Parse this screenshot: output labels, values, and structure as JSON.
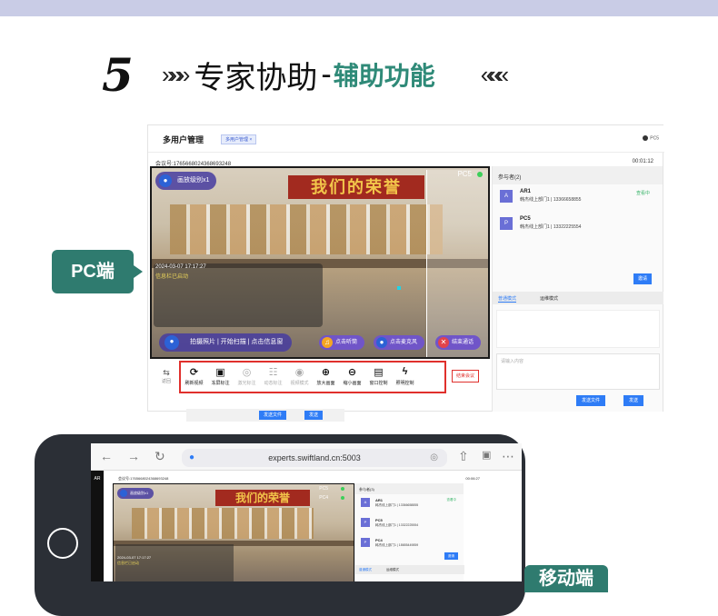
{
  "heading": {
    "number": "5",
    "chevrons_left": "»»»",
    "title": "专家协助",
    "separator": "-",
    "subtitle": "辅助功能",
    "chevrons_right": "«««"
  },
  "colors": {
    "accent": "#2f7b6f",
    "subtitle": "#2f8a78",
    "highlight_border": "#e0302c",
    "primary_button": "#2e7cf6",
    "top_bar": "#c9cce6"
  },
  "labels": {
    "pc": "PC端",
    "mobile": "移动端"
  },
  "pc": {
    "app_title": "多用户管理",
    "app_tab": "多用户管理 ×",
    "user": "PC5",
    "meeting_id": "会议号:1765668024368693248",
    "timer": "00:01:12",
    "video": {
      "scale_pill": "画放级别x1",
      "banner": "我们的荣誉",
      "feed_label": "PC5",
      "timestamp": "2024-03-07 17:17:27",
      "info": "信息栏已启动",
      "capture_hint": "拍摄照片 | 开始扫描 | 点击信息窗",
      "listen": "点击听筒",
      "mic": "点击麦克风",
      "end_call": "结束通话"
    },
    "back": {
      "icon": "back-arrow-icon",
      "label": "返回"
    },
    "tools": [
      {
        "icon": "⟳",
        "label": "刷新视频",
        "enabled": true
      },
      {
        "icon": "▣",
        "label": "冻屏标注",
        "enabled": true
      },
      {
        "icon": "◎",
        "label": "激光标注",
        "enabled": false
      },
      {
        "icon": "☷",
        "label": "动态标注",
        "enabled": false
      },
      {
        "icon": "◉",
        "label": "视频模式",
        "enabled": false
      },
      {
        "icon": "⊕",
        "label": "放大画面",
        "enabled": true
      },
      {
        "icon": "⊖",
        "label": "缩小画面",
        "enabled": true
      },
      {
        "icon": "▤",
        "label": "窗口控制",
        "enabled": true
      },
      {
        "icon": "ϟ",
        "label": "照明控制",
        "enabled": true
      }
    ],
    "end_meeting": "结束会议",
    "bottom_send_file": "发送文件",
    "bottom_send": "发送",
    "participants_title": "参与者(2)",
    "participants": [
      {
        "avatar": "A",
        "name": "AR1",
        "dept": "韩杰线上部门1 | 13366658855",
        "status": "查看中"
      },
      {
        "avatar": "P",
        "name": "PC5",
        "dept": "韩杰线上部门1 | 13322225554",
        "status": ""
      }
    ],
    "invite": "邀请",
    "tab_normal": "普通模式",
    "tab_remote": "运维模式",
    "input_placeholder": "请输入内容",
    "send_file": "发送文件",
    "send": "发送"
  },
  "mobile": {
    "url": "experts.swiftland.cn:5003",
    "side_label": "AR",
    "meeting_id": "会议号:1765668024368693248",
    "timer": "00:06:27",
    "scale_pill": "画放级别x1",
    "banner": "我们的荣誉",
    "feeds": [
      "PC5",
      "PC4"
    ],
    "timestamp": "2024-03-07 17:17:27",
    "info": "信息栏已启动",
    "participants_title": "参与者(3)",
    "participants": [
      {
        "avatar": "A",
        "name": "AR1",
        "dept": "韩杰线上部门1 | 13366658855",
        "status": "查看中"
      },
      {
        "avatar": "P",
        "name": "PC5",
        "dept": "韩杰线上部门1 | 13322225554",
        "status": ""
      },
      {
        "avatar": "P",
        "name": "PC4",
        "dept": "韩杰线上部门1 | 18655449859",
        "status": ""
      }
    ],
    "invite": "邀请",
    "tab_normal": "普通模式",
    "tab_remote": "运维模式"
  }
}
